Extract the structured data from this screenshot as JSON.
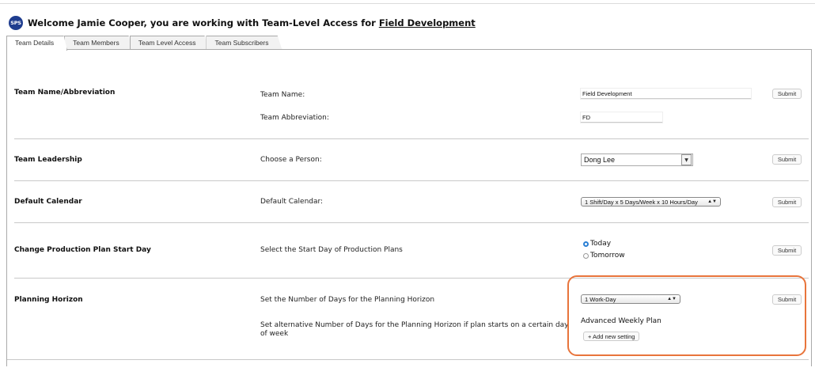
{
  "header": {
    "logo_text": "SPS",
    "welcome_prefix": "Welcome Jamie Cooper, you are working with Team-Level Access for ",
    "team_link": "Field Development"
  },
  "tabs": [
    {
      "label": "Team Details",
      "active": true
    },
    {
      "label": "Team Members",
      "active": false
    },
    {
      "label": "Team Level Access",
      "active": false
    },
    {
      "label": "Team Subscribers",
      "active": false
    }
  ],
  "sections": {
    "team_name": {
      "title": "Team Name/Abbreviation",
      "name_label": "Team Name:",
      "name_value": "Field Development",
      "abbr_label": "Team Abbreviation:",
      "abbr_value": "FD",
      "submit": "Submit"
    },
    "leadership": {
      "title": "Team Leadership",
      "label": "Choose a Person:",
      "value": "Dong Lee",
      "submit": "Submit"
    },
    "calendar": {
      "title": "Default Calendar",
      "label": "Default Calendar:",
      "value": "1 Shift/Day x 5 Days/Week x 10 Hours/Day",
      "submit": "Submit"
    },
    "start_day": {
      "title": "Change Production Plan Start Day",
      "label": "Select the Start Day of Production Plans",
      "options": [
        "Today",
        "Tomorrow"
      ],
      "selected": "Today",
      "submit": "Submit"
    },
    "horizon": {
      "title": "Planning Horizon",
      "label": "Set the Number of Days for the Planning Horizon",
      "value": "1 Work-Day",
      "alt_label": "Set alternative Number of Days for the Planning Horizon if plan starts on a certain day of week",
      "advanced": "Advanced Weekly Plan",
      "add_setting": "+ Add new setting",
      "submit": "Submit"
    }
  },
  "colors": {
    "logo": "#1f3d8f",
    "highlight": "#e8743b",
    "radio_selected": "#2a7fd4"
  }
}
